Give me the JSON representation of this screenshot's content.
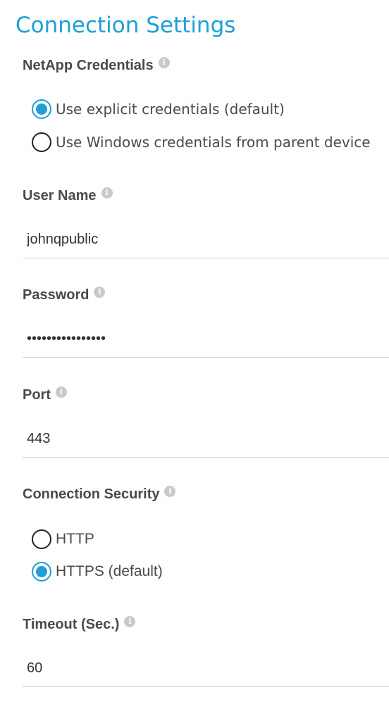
{
  "page": {
    "title": "Connection Settings"
  },
  "netapp_credentials": {
    "label": "NetApp Credentials",
    "options": [
      {
        "label": "Use explicit credentials (default)",
        "checked": true
      },
      {
        "label": "Use Windows credentials from parent device",
        "checked": false
      }
    ]
  },
  "user_name": {
    "label": "User Name",
    "value": "johnqpublic"
  },
  "password": {
    "label": "Password",
    "value": "••••••••••••••••"
  },
  "port": {
    "label": "Port",
    "value": "443"
  },
  "connection_security": {
    "label": "Connection Security",
    "options": [
      {
        "label": "HTTP",
        "checked": false
      },
      {
        "label": "HTTPS (default)",
        "checked": true
      }
    ]
  },
  "timeout": {
    "label": "Timeout (Sec.)",
    "value": "60"
  },
  "icons": {
    "info": "info-icon",
    "radio_checked": "radio-checked",
    "radio_unchecked": "radio-unchecked"
  },
  "colors": {
    "accent": "#1f9fd6",
    "label": "#4a4a4a",
    "divider": "#d0d0d0"
  }
}
